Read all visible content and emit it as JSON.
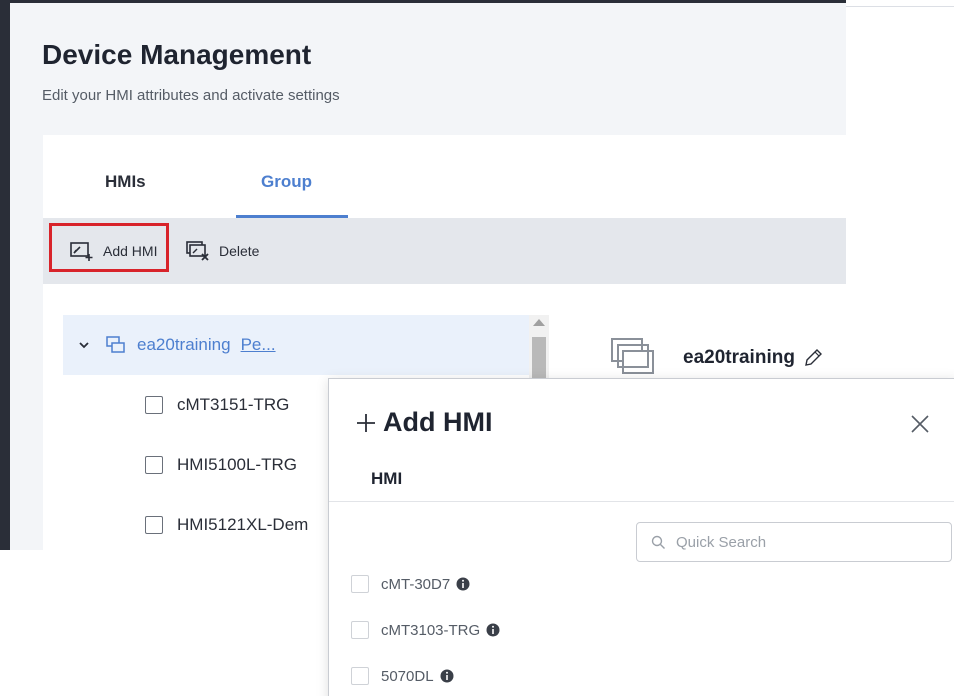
{
  "page": {
    "title": "Device Management",
    "subtitle": "Edit your HMI attributes and activate settings"
  },
  "tabs": {
    "hmis": "HMIs",
    "group": "Group",
    "active": "Group"
  },
  "toolbar": {
    "add_hmi": "Add HMI",
    "delete": "Delete"
  },
  "tree": {
    "group_name": "ea20training",
    "group_link": "Pe...",
    "devices": [
      "cMT3151-TRG",
      "HMI5100L-TRG",
      "HMI5121XL-Dem"
    ]
  },
  "detail": {
    "name": "ea20training"
  },
  "dialog": {
    "title": "Add HMI",
    "tab": "HMI",
    "search_placeholder": "Quick Search",
    "items": [
      "cMT-30D7",
      "cMT3103-TRG",
      "5070DL"
    ]
  },
  "colors": {
    "accent": "#4d7fcf",
    "highlight": "#d8232a",
    "toolbar_bg": "#e4e7ec"
  },
  "icons": [
    "add-hmi-icon",
    "delete-icon",
    "chevron-down-icon",
    "group-icon",
    "checkbox",
    "pencil-icon",
    "plus-icon",
    "close-icon",
    "search-icon",
    "info-icon"
  ]
}
